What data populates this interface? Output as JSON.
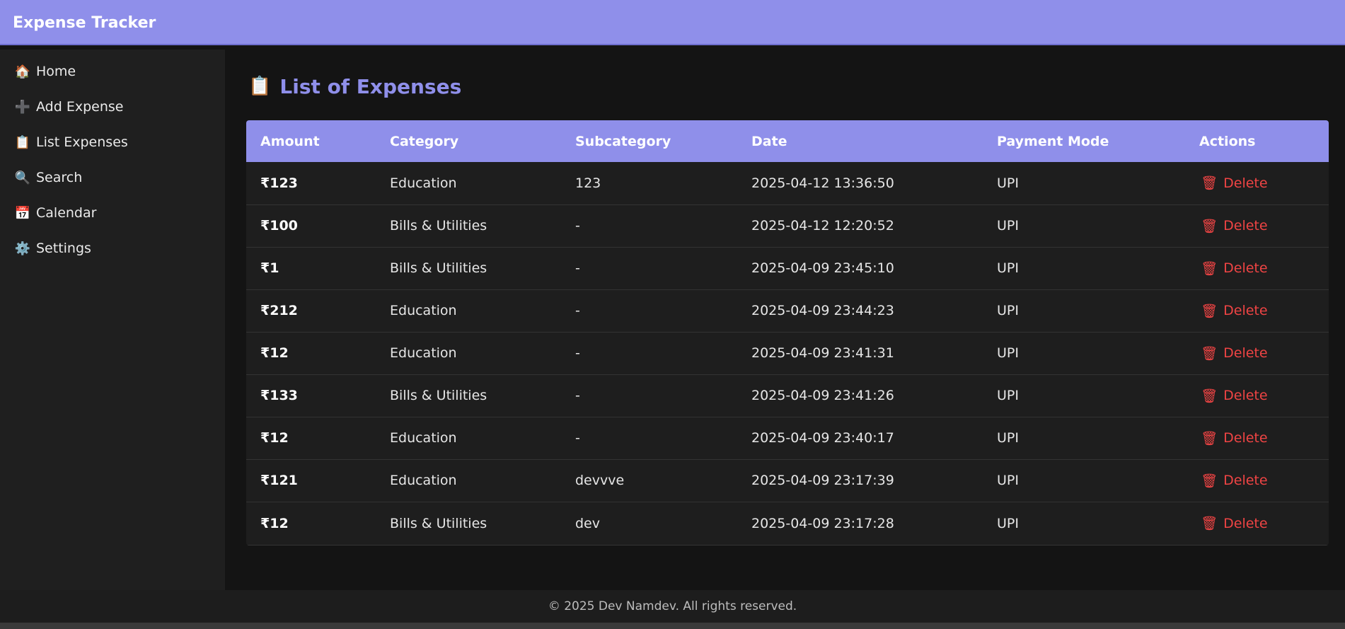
{
  "app": {
    "title": "Expense Tracker"
  },
  "sidebar": {
    "items": [
      {
        "icon": "🏠",
        "label": "Home"
      },
      {
        "icon": "➕",
        "label": "Add Expense"
      },
      {
        "icon": "📋",
        "label": "List Expenses"
      },
      {
        "icon": "🔍",
        "label": "Search"
      },
      {
        "icon": "📅",
        "label": "Calendar"
      },
      {
        "icon": "⚙️",
        "label": "Settings"
      }
    ]
  },
  "main": {
    "title_icon": "📋",
    "title": "List of Expenses",
    "table": {
      "headers": [
        "Amount",
        "Category",
        "Subcategory",
        "Date",
        "Payment Mode",
        "Actions"
      ],
      "delete_icon": "🗑",
      "delete_label": "Delete",
      "rows": [
        {
          "amount": "₹123",
          "category": "Education",
          "subcategory": "123",
          "date": "2025-04-12 13:36:50",
          "payment_mode": "UPI"
        },
        {
          "amount": "₹100",
          "category": "Bills & Utilities",
          "subcategory": "-",
          "date": "2025-04-12 12:20:52",
          "payment_mode": "UPI"
        },
        {
          "amount": "₹1",
          "category": "Bills & Utilities",
          "subcategory": "-",
          "date": "2025-04-09 23:45:10",
          "payment_mode": "UPI"
        },
        {
          "amount": "₹212",
          "category": "Education",
          "subcategory": "-",
          "date": "2025-04-09 23:44:23",
          "payment_mode": "UPI"
        },
        {
          "amount": "₹12",
          "category": "Education",
          "subcategory": "-",
          "date": "2025-04-09 23:41:31",
          "payment_mode": "UPI"
        },
        {
          "amount": "₹133",
          "category": "Bills & Utilities",
          "subcategory": "-",
          "date": "2025-04-09 23:41:26",
          "payment_mode": "UPI"
        },
        {
          "amount": "₹12",
          "category": "Education",
          "subcategory": "-",
          "date": "2025-04-09 23:40:17",
          "payment_mode": "UPI"
        },
        {
          "amount": "₹121",
          "category": "Education",
          "subcategory": "devvve",
          "date": "2025-04-09 23:17:39",
          "payment_mode": "UPI"
        },
        {
          "amount": "₹12",
          "category": "Bills & Utilities",
          "subcategory": "dev",
          "date": "2025-04-09 23:17:28",
          "payment_mode": "UPI"
        }
      ]
    }
  },
  "footer": {
    "text": "© 2025 Dev Namdev. All rights reserved."
  },
  "colors": {
    "accent": "#8f8fea",
    "delete": "#ef4444",
    "background": "#141414",
    "sidebar": "#1f1f1f"
  }
}
